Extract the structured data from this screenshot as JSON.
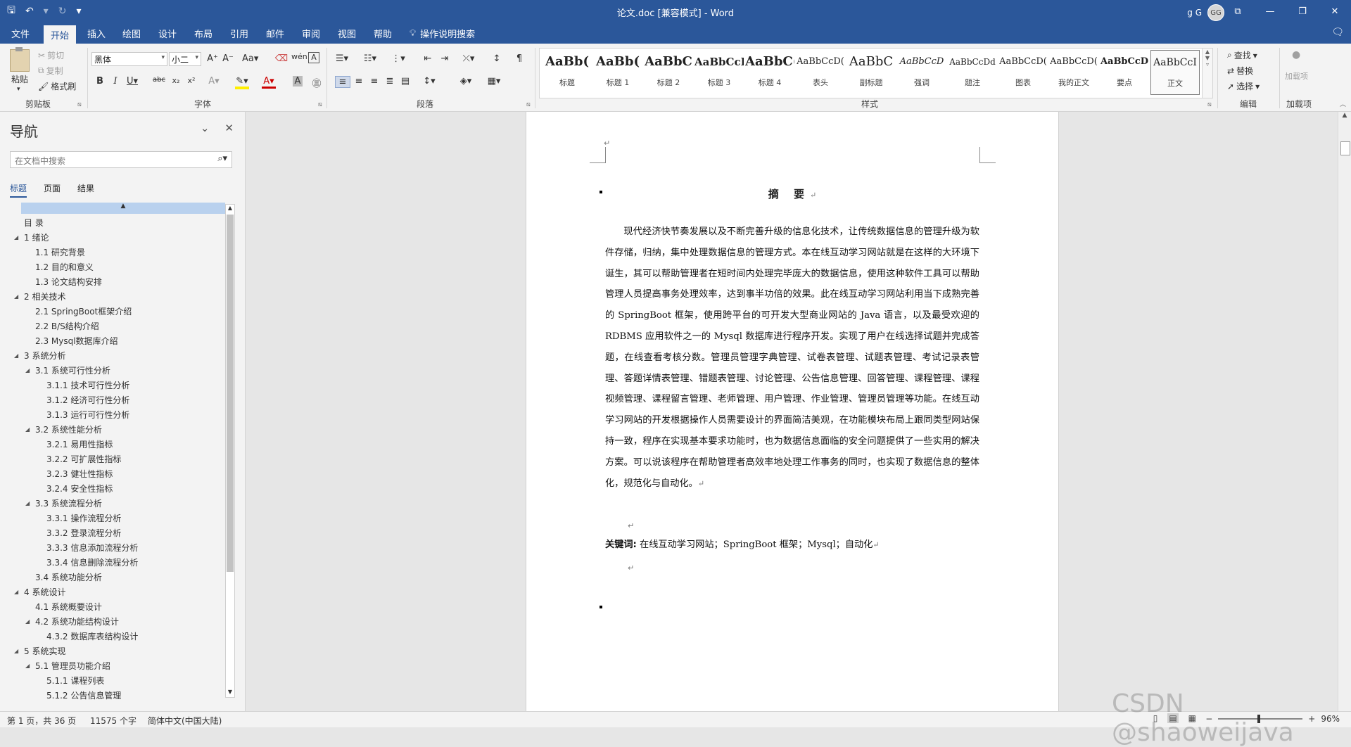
{
  "app": {
    "title": "论文.doc [兼容模式] - Word",
    "user_name": "g G",
    "user_initials": "GG"
  },
  "quick_access": {
    "save_icon": "save-icon",
    "undo_icon": "undo-icon",
    "redo_icon": "redo-icon"
  },
  "ribbon_tabs": [
    "文件",
    "开始",
    "插入",
    "绘图",
    "设计",
    "布局",
    "引用",
    "邮件",
    "审阅",
    "视图",
    "帮助"
  ],
  "active_tab": "开始",
  "tell_me": "操作说明搜索",
  "clipboard": {
    "paste": "粘贴",
    "cut": "剪切",
    "copy": "复制",
    "format_painter": "格式刷",
    "label": "剪贴板"
  },
  "font": {
    "name": "黑体",
    "size": "小二",
    "label": "字体"
  },
  "paragraph": {
    "label": "段落"
  },
  "styles": {
    "label": "样式",
    "items": [
      {
        "sample": "AaBb(",
        "name": "标题"
      },
      {
        "sample": "AaBb(",
        "name": "标题 1"
      },
      {
        "sample": "AaBbC",
        "name": "标题 2"
      },
      {
        "sample": "AaBbCcI",
        "name": "标题 3"
      },
      {
        "sample": "AaBbC(",
        "name": "标题 4"
      },
      {
        "sample": "AaBbCcD(",
        "name": "表头"
      },
      {
        "sample": "AaBbC",
        "name": "副标题"
      },
      {
        "sample": "AaBbCcD",
        "name": "强调"
      },
      {
        "sample": "AaBbCcDd",
        "name": "题注"
      },
      {
        "sample": "AaBbCcD(",
        "name": "图表"
      },
      {
        "sample": "AaBbCcD(",
        "name": "我的正文"
      },
      {
        "sample": "AaBbCcD",
        "name": "要点"
      },
      {
        "sample": "AaBbCcI",
        "name": "正文"
      }
    ]
  },
  "editing": {
    "find": "查找",
    "replace": "替换",
    "select": "选择",
    "label": "编辑"
  },
  "addins": {
    "button": "加载项",
    "label": "加载项"
  },
  "nav": {
    "title": "导航",
    "search_placeholder": "在文档中搜索",
    "tabs": [
      "标题",
      "页面",
      "结果"
    ],
    "items": [
      {
        "text": "目 录",
        "level": 0,
        "expand": false
      },
      {
        "text": "1 绪论",
        "level": 0,
        "expand": true
      },
      {
        "text": "1.1 研究背景",
        "level": 1,
        "expand": false
      },
      {
        "text": "1.2 目的和意义",
        "level": 1,
        "expand": false
      },
      {
        "text": "1.3 论文结构安排",
        "level": 1,
        "expand": false
      },
      {
        "text": "2 相关技术",
        "level": 0,
        "expand": true
      },
      {
        "text": "2.1 SpringBoot框架介绍",
        "level": 1,
        "expand": false
      },
      {
        "text": "2.2 B/S结构介绍",
        "level": 1,
        "expand": false
      },
      {
        "text": "2.3 Mysql数据库介绍",
        "level": 1,
        "expand": false
      },
      {
        "text": "3 系统分析",
        "level": 0,
        "expand": true
      },
      {
        "text": "3.1 系统可行性分析",
        "level": 1,
        "expand": true
      },
      {
        "text": "3.1.1 技术可行性分析",
        "level": 2,
        "expand": false
      },
      {
        "text": "3.1.2 经济可行性分析",
        "level": 2,
        "expand": false
      },
      {
        "text": "3.1.3 运行可行性分析",
        "level": 2,
        "expand": false
      },
      {
        "text": "3.2 系统性能分析",
        "level": 1,
        "expand": true
      },
      {
        "text": "3.2.1 易用性指标",
        "level": 2,
        "expand": false
      },
      {
        "text": "3.2.2 可扩展性指标",
        "level": 2,
        "expand": false
      },
      {
        "text": "3.2.3 健壮性指标",
        "level": 2,
        "expand": false
      },
      {
        "text": "3.2.4 安全性指标",
        "level": 2,
        "expand": false
      },
      {
        "text": "3.3 系统流程分析",
        "level": 1,
        "expand": true
      },
      {
        "text": "3.3.1 操作流程分析",
        "level": 2,
        "expand": false
      },
      {
        "text": "3.3.2 登录流程分析",
        "level": 2,
        "expand": false
      },
      {
        "text": "3.3.3 信息添加流程分析",
        "level": 2,
        "expand": false
      },
      {
        "text": "3.3.4 信息删除流程分析",
        "level": 2,
        "expand": false
      },
      {
        "text": "3.4 系统功能分析",
        "level": 1,
        "expand": false
      },
      {
        "text": "4 系统设计",
        "level": 0,
        "expand": true
      },
      {
        "text": "4.1 系统概要设计",
        "level": 1,
        "expand": false
      },
      {
        "text": "4.2 系统功能结构设计",
        "level": 1,
        "expand": true
      },
      {
        "text": "4.3.2 数据库表结构设计",
        "level": 2,
        "expand": false
      },
      {
        "text": "5 系统实现",
        "level": 0,
        "expand": true
      },
      {
        "text": "5.1 管理员功能介绍",
        "level": 1,
        "expand": true
      },
      {
        "text": "5.1.1 课程列表",
        "level": 2,
        "expand": false
      },
      {
        "text": "5.1.2 公告信息管理",
        "level": 2,
        "expand": false
      }
    ]
  },
  "document": {
    "abstract_title": "摘 要",
    "abstract_body": "现代经济快节奏发展以及不断完善升级的信息化技术，让传统数据信息的管理升级为软件存储，归纳，集中处理数据信息的管理方式。本在线互动学习网站就是在这样的大环境下诞生，其可以帮助管理者在短时间内处理完毕庞大的数据信息，使用这种软件工具可以帮助管理人员提高事务处理效率，达到事半功倍的效果。此在线互动学习网站利用当下成熟完善的 SpringBoot 框架，使用跨平台的可开发大型商业网站的 Java 语言，以及最受欢迎的 RDBMS 应用软件之一的 Mysql 数据库进行程序开发。实现了用户在线选择试题并完成答题，在线查看考核分数。管理员管理字典管理、试卷表管理、试题表管理、考试记录表管理、答题详情表管理、错题表管理、讨论管理、公告信息管理、回答管理、课程管理、课程视频管理、课程留言管理、老师管理、用户管理、作业管理、管理员管理等功能。在线互动学习网站的开发根据操作人员需要设计的界面简洁美观，在功能模块布局上跟同类型网站保持一致，程序在实现基本要求功能时，也为数据信息面临的安全问题提供了一些实用的解决方案。可以说该程序在帮助管理者高效率地处理工作事务的同时，也实现了数据信息的整体化，规范化与自动化。",
    "keywords_label": "关键词:",
    "keywords_text": "在线互动学习网站；SpringBoot 框架；Mysql；自动化"
  },
  "status": {
    "page": "第 1 页，共 36 页",
    "words": "11575 个字",
    "language": "简体中文(中国大陆)",
    "zoom": "96%",
    "zoom_value": 96
  },
  "watermark": "CSDN @shaoweijava"
}
